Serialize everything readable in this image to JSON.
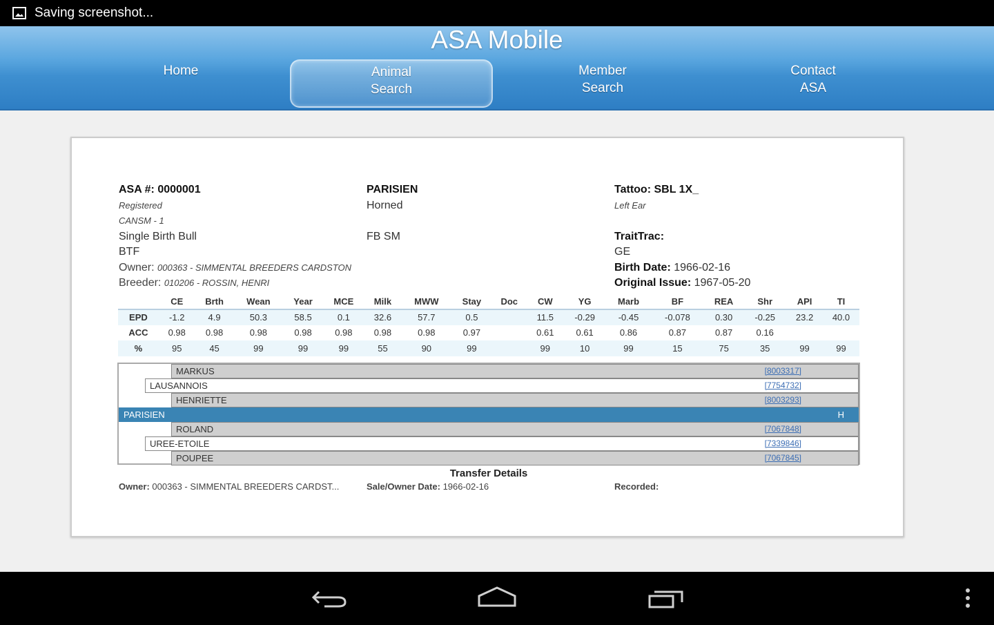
{
  "status_bar": {
    "notification": "Saving screenshot..."
  },
  "header": {
    "title": "ASA Mobile"
  },
  "nav": {
    "home": "Home",
    "animal_search": [
      "Animal",
      "Search"
    ],
    "member_search": [
      "Member",
      "Search"
    ],
    "contact": [
      "Contact",
      "ASA"
    ]
  },
  "animal": {
    "asa_label": "ASA #:",
    "asa_number": "0000001",
    "status": "Registered",
    "cansm": "CANSM - 1",
    "birth_type": "Single Birth Bull",
    "btf": "BTF",
    "owner_label": "Owner:",
    "owner": "000363 - SIMMENTAL BREEDERS CARDSTON",
    "breeder_label": "Breeder:",
    "breeder": "010206 - ROSSIN, HENRI",
    "name": "PARISIEN",
    "horned": "Horned",
    "breed": "FB SM",
    "tattoo_label": "Tattoo:",
    "tattoo": "SBL 1X_",
    "tattoo_location": "Left Ear",
    "traittrac_label": "TraitTrac:",
    "ge": "GE",
    "birth_date_label": "Birth Date:",
    "birth_date": "1966-02-16",
    "original_issue_label": "Original Issue:",
    "original_issue": "1967-05-20"
  },
  "epd": {
    "headers": [
      "",
      "CE",
      "Brth",
      "Wean",
      "Year",
      "MCE",
      "Milk",
      "MWW",
      "Stay",
      "Doc",
      "CW",
      "YG",
      "Marb",
      "BF",
      "REA",
      "Shr",
      "API",
      "TI"
    ],
    "rows": [
      [
        "EPD",
        "-1.2",
        "4.9",
        "50.3",
        "58.5",
        "0.1",
        "32.6",
        "57.7",
        "0.5",
        "",
        "11.5",
        "-0.29",
        "-0.45",
        "-0.078",
        "0.30",
        "-0.25",
        "23.2",
        "40.0"
      ],
      [
        "ACC",
        "0.98",
        "0.98",
        "0.98",
        "0.98",
        "0.98",
        "0.98",
        "0.98",
        "0.97",
        "",
        "0.61",
        "0.61",
        "0.86",
        "0.87",
        "0.87",
        "0.16",
        "",
        ""
      ],
      [
        "%",
        "95",
        "45",
        "99",
        "99",
        "99",
        "55",
        "90",
        "99",
        "",
        "99",
        "10",
        "99",
        "15",
        "75",
        "35",
        "99",
        "99"
      ]
    ]
  },
  "pedigree": [
    {
      "name": "MARKUS",
      "link": "[8003317]"
    },
    {
      "name": "LAUSANNOIS",
      "link": "[7754732]"
    },
    {
      "name": "HENRIETTE",
      "link": "[8003293]"
    },
    {
      "name": "PARISIEN",
      "flag": "H"
    },
    {
      "name": "ROLAND",
      "link": "[7067848]"
    },
    {
      "name": "UREE-ETOILE",
      "link": "[7339846]"
    },
    {
      "name": "POUPEE",
      "link": "[7067845]"
    }
  ],
  "transfer": {
    "title": "Transfer Details",
    "owner_label": "Owner:",
    "owner": "000363 - SIMMENTAL BREEDERS CARDST...",
    "sale_label": "Sale/Owner Date:",
    "sale_date": "1966-02-16",
    "recorded_label": "Recorded:"
  }
}
